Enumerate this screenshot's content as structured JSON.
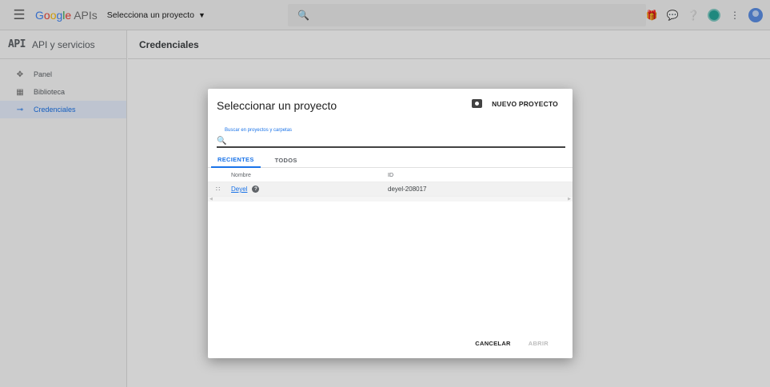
{
  "topbar": {
    "brand_google": [
      "G",
      "o",
      "o",
      "g",
      "l",
      "e"
    ],
    "brand_apis": "APIs",
    "project_select": "Selecciona un proyecto",
    "icons": [
      "menu-icon",
      "search-icon",
      "gift-icon",
      "chat-icon",
      "help-icon",
      "notifications-icon",
      "more-vert-icon",
      "account-icon"
    ]
  },
  "sidebar": {
    "logo": "API",
    "title": "API y servicios",
    "items": [
      {
        "label": "Panel",
        "icon": "dashboard-icon"
      },
      {
        "label": "Biblioteca",
        "icon": "library-icon"
      },
      {
        "label": "Credenciales",
        "icon": "key-icon",
        "active": true
      }
    ]
  },
  "main": {
    "title": "Credenciales"
  },
  "dialog": {
    "title": "Seleccionar un proyecto",
    "new_project": "NUEVO PROYECTO",
    "search_label": "Buscar en proyectos y carpetas",
    "search_value": "",
    "tabs": [
      {
        "label": "RECIENTES",
        "active": true
      },
      {
        "label": "TODOS",
        "active": false
      }
    ],
    "table": {
      "headers": {
        "name": "Nombre",
        "id": "ID"
      },
      "rows": [
        {
          "name": "Deyel",
          "id": "deyel-208017"
        }
      ]
    },
    "cancel": "CANCELAR",
    "open": "ABRIR"
  },
  "colors": {
    "accent": "#1a73e8",
    "overlay": "rgba(0,0,0,0.18)"
  }
}
